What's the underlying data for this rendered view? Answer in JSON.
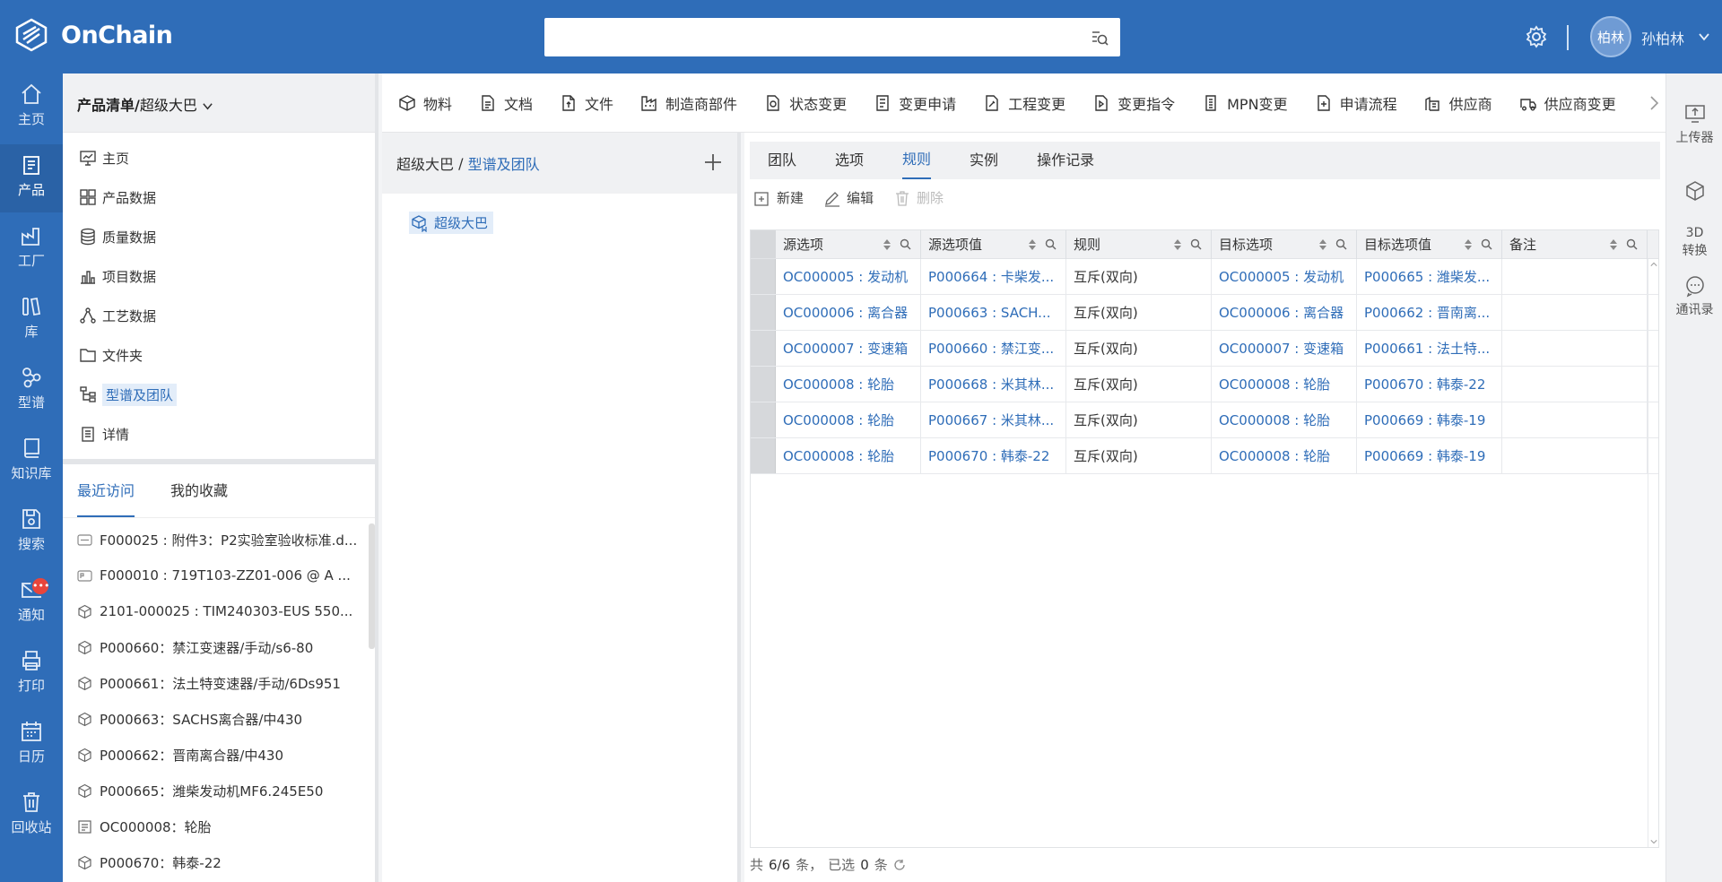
{
  "app": {
    "name": "OnChain"
  },
  "header": {
    "search_placeholder": "",
    "avatar_text": "柏林",
    "username": "孙柏林"
  },
  "rail": [
    {
      "label": "主页",
      "icon": "home-icon"
    },
    {
      "label": "产品",
      "icon": "product-icon",
      "active": true
    },
    {
      "label": "工厂",
      "icon": "factory-icon"
    },
    {
      "label": "库",
      "icon": "library-icon"
    },
    {
      "label": "型谱",
      "icon": "spectrum-icon"
    },
    {
      "label": "知识库",
      "icon": "knowledge-icon"
    },
    {
      "label": "搜索",
      "icon": "search-save-icon"
    },
    {
      "label": "通知",
      "icon": "mail-icon",
      "badge": "•••"
    },
    {
      "label": "打印",
      "icon": "printer-icon"
    },
    {
      "label": "日历",
      "icon": "calendar-icon"
    },
    {
      "label": "回收站",
      "icon": "trash-icon"
    }
  ],
  "left_panel": {
    "title_bold": "产品清单/",
    "title_rest": "超级大巴",
    "items": [
      {
        "label": "主页",
        "icon": "monitor-icon"
      },
      {
        "label": "产品数据",
        "icon": "grid-icon"
      },
      {
        "label": "质量数据",
        "icon": "database-icon"
      },
      {
        "label": "项目数据",
        "icon": "bar-chart-icon"
      },
      {
        "label": "工艺数据",
        "icon": "process-icon"
      },
      {
        "label": "文件夹",
        "icon": "folder-icon"
      },
      {
        "label": "型谱及团队",
        "icon": "tree-icon",
        "selected": true
      },
      {
        "label": "详情",
        "icon": "details-icon"
      }
    ]
  },
  "recent": {
    "tabs": [
      "最近访问",
      "我的收藏"
    ],
    "items": [
      {
        "text": "F000025 : 附件3：P2实验室验收标准.d...",
        "icon": "docx-file-icon"
      },
      {
        "text": "F000010 : 719T103-ZZ01-006 @ A ...",
        "icon": "pdf-file-icon"
      },
      {
        "text": "2101-000025 : TIM240303-EUS 550...",
        "icon": "cube-icon"
      },
      {
        "text": "P000660：禁江变速器/手动/s6-80",
        "icon": "cube-icon"
      },
      {
        "text": "P000661：法土特变速器/手动/6Ds951",
        "icon": "cube-icon"
      },
      {
        "text": "P000663：SACHS离合器/中430",
        "icon": "cube-icon"
      },
      {
        "text": "P000662：晋南离合器/中430",
        "icon": "cube-icon"
      },
      {
        "text": "P000665：潍柴发动机MF6.245E50",
        "icon": "cube-icon"
      },
      {
        "text": "OC000008：轮胎",
        "icon": "option-icon"
      },
      {
        "text": "P000670：韩泰-22",
        "icon": "cube-icon"
      }
    ]
  },
  "toolbar": [
    {
      "label": "物料",
      "icon": "cube-icon"
    },
    {
      "label": "文档",
      "icon": "document-icon"
    },
    {
      "label": "文件",
      "icon": "file-icon"
    },
    {
      "label": "制造商部件",
      "icon": "manufacturer-icon"
    },
    {
      "label": "状态变更",
      "icon": "status-change-icon"
    },
    {
      "label": "变更申请",
      "icon": "change-request-icon"
    },
    {
      "label": "工程变更",
      "icon": "engineering-change-icon"
    },
    {
      "label": "变更指令",
      "icon": "change-order-icon"
    },
    {
      "label": "MPN变更",
      "icon": "mpn-icon"
    },
    {
      "label": "申请流程",
      "icon": "application-icon"
    },
    {
      "label": "供应商",
      "icon": "supplier-icon"
    },
    {
      "label": "供应商变更",
      "icon": "supplier-change-icon"
    }
  ],
  "mid_panel": {
    "crumb_root": "超级大巴",
    "crumb_sep": " / ",
    "crumb_current": "型谱及团队",
    "node": "超级大巴"
  },
  "tabs": [
    {
      "label": "团队"
    },
    {
      "label": "选项"
    },
    {
      "label": "规则",
      "active": true
    },
    {
      "label": "实例"
    },
    {
      "label": "操作记录"
    }
  ],
  "actions": {
    "new": "新建",
    "edit": "编辑",
    "delete": "删除"
  },
  "table": {
    "columns": [
      "源选项",
      "源选项值",
      "规则",
      "目标选项",
      "目标选项值",
      "备注"
    ],
    "rows": [
      [
        "OC000005 : 发动机",
        "P000664 : 卡柴发...",
        "互斥(双向)",
        "OC000005 : 发动机",
        "P000665 : 潍柴发...",
        ""
      ],
      [
        "OC000006 : 离合器",
        "P000663 : SACH...",
        "互斥(双向)",
        "OC000006 : 离合器",
        "P000662 : 晋南离...",
        ""
      ],
      [
        "OC000007 : 变速箱",
        "P000660 : 禁江变...",
        "互斥(双向)",
        "OC000007 : 变速箱",
        "P000661 : 法土特...",
        ""
      ],
      [
        "OC000008 : 轮胎",
        "P000668 : 米其林...",
        "互斥(双向)",
        "OC000008 : 轮胎",
        "P000670 : 韩泰-22",
        ""
      ],
      [
        "OC000008 : 轮胎",
        "P000667 : 米其林...",
        "互斥(双向)",
        "OC000008 : 轮胎",
        "P000669 : 韩泰-19",
        ""
      ],
      [
        "OC000008 : 轮胎",
        "P000670 : 韩泰-22",
        "互斥(双向)",
        "OC000008 : 轮胎",
        "P000669 : 韩泰-19",
        ""
      ]
    ]
  },
  "footer": {
    "total_prefix": "共",
    "total": "6/6",
    "total_suffix": "条，",
    "selected_prefix": "已选",
    "selected": "0",
    "selected_suffix": "条"
  },
  "right_rail": [
    {
      "label": "上传器",
      "icon": "uploader-icon"
    },
    {
      "label": "3D\n转换",
      "icon": "3d-convert-icon"
    },
    {
      "label": "通讯录",
      "icon": "contacts-icon"
    }
  ],
  "colors": {
    "brand": "#2f6db8",
    "link": "#2f6db8",
    "badge": "#e8453c"
  }
}
